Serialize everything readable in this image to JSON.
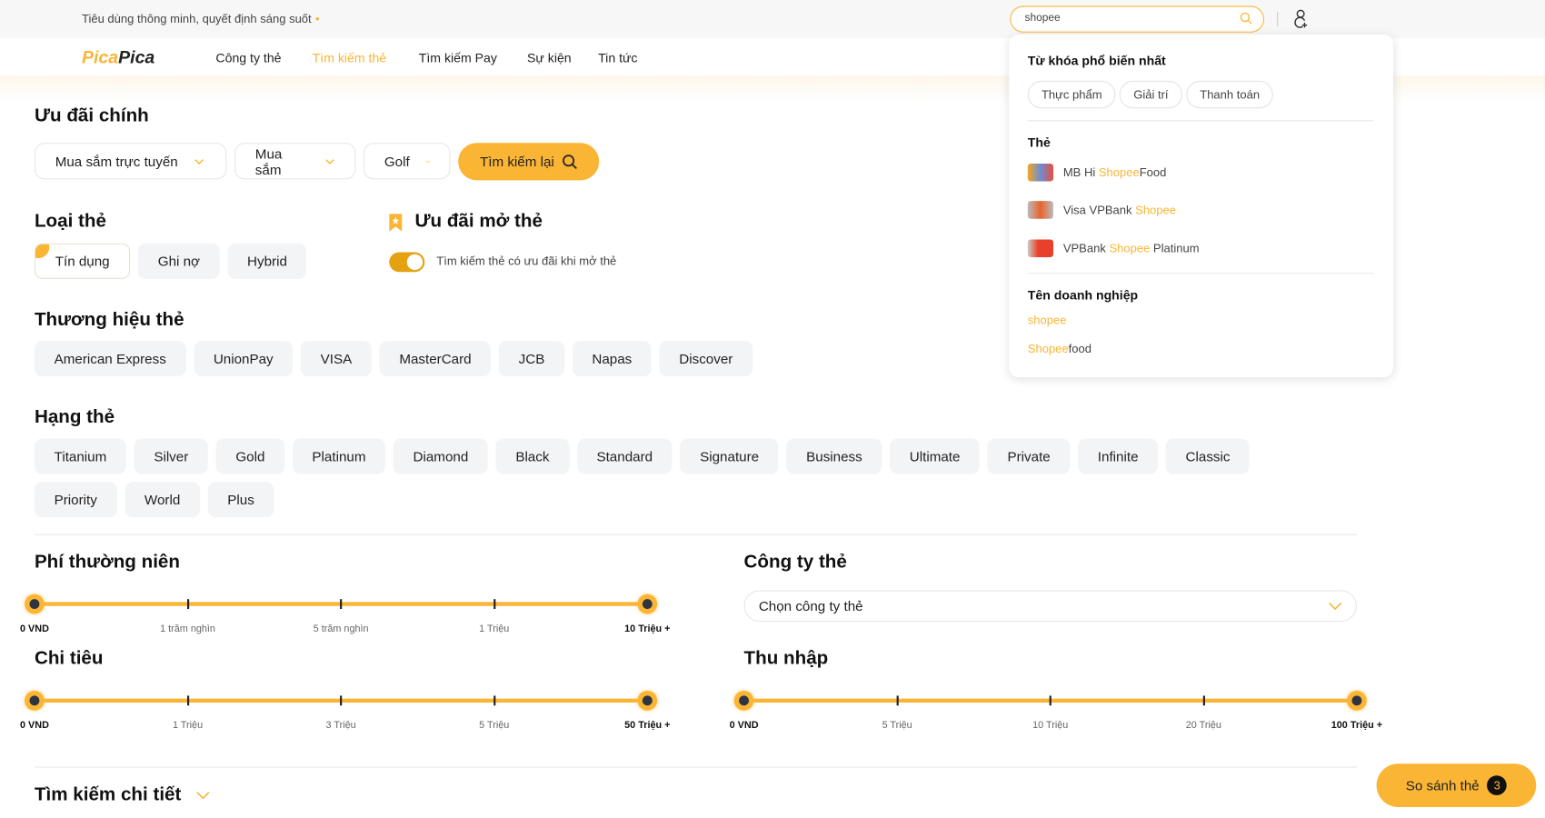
{
  "header": {
    "tagline": "Tiêu dùng thông minh, quyết định sáng suốt",
    "search_value": "shopee",
    "logo": {
      "part1": "Pica",
      "part2": "Pica"
    },
    "nav": [
      {
        "label": "Công ty thẻ",
        "active": false
      },
      {
        "label": "Tìm kiếm thẻ",
        "active": true
      },
      {
        "label": "Tìm kiếm Pay",
        "active": false
      },
      {
        "label": "Sự kiện",
        "active": false
      },
      {
        "label": "Tin tức",
        "active": false
      }
    ]
  },
  "colors": {
    "accent": "#fbb534",
    "toggle": "#e5a10f",
    "chip_bg": "#f3f4f6"
  },
  "main_offer": {
    "title": "Ưu đãi chính",
    "dropdowns": [
      "Mua sắm trực tuyến",
      "Mua sắm",
      "Golf"
    ],
    "search_again": "Tìm kiếm lại"
  },
  "card_type": {
    "title": "Loại thẻ",
    "options": [
      "Tín dụng",
      "Ghi nợ",
      "Hybrid"
    ],
    "selected": "Tín dụng"
  },
  "open_offer": {
    "title": "Ưu đãi mở thẻ",
    "toggle_label": "Tìm kiếm thẻ có ưu đãi khi mở thẻ",
    "toggle_on": true
  },
  "brand": {
    "title": "Thương hiệu thẻ",
    "options": [
      "American Express",
      "UnionPay",
      "VISA",
      "MasterCard",
      "JCB",
      "Napas",
      "Discover"
    ]
  },
  "tier": {
    "title": "Hạng thẻ",
    "row1": [
      "Titanium",
      "Silver",
      "Gold",
      "Platinum",
      "Diamond",
      "Black",
      "Standard",
      "Signature",
      "Business",
      "Ultimate",
      "Private",
      "Infinite",
      "Classic"
    ],
    "row2": [
      "Priority",
      "World",
      "Plus"
    ]
  },
  "annual_fee": {
    "title": "Phí thường niên",
    "labels": [
      "0 VND",
      "1 trăm nghìn",
      "5 trăm nghìn",
      "1 Triệu",
      "10 Triệu +"
    ],
    "min": "0 VND",
    "max": "10 Triệu +"
  },
  "spending": {
    "title": "Chi tiêu",
    "labels": [
      "0 VND",
      "1 Triệu",
      "3 Triệu",
      "5 Triệu",
      "50 Triệu +"
    ],
    "min": "0 VND",
    "max": "50 Triệu +"
  },
  "company": {
    "title": "Công ty thẻ",
    "placeholder": "Chọn công ty thẻ"
  },
  "income": {
    "title": "Thu nhập",
    "labels": [
      "0 VND",
      "5 Triệu",
      "10 Triệu",
      "20 Triệu",
      "100 Triệu +"
    ],
    "min": "0 VND",
    "max": "100 Triệu +"
  },
  "detail_search": "Tìm kiếm chi tiết",
  "compare": {
    "label": "So sánh thẻ",
    "count": "3"
  },
  "suggest": {
    "popular_title": "Từ khóa phổ biến nhất",
    "keywords": [
      "Thực phẩm",
      "Giải trí",
      "Thanh toán"
    ],
    "cards_title": "Thẻ",
    "cards": [
      {
        "pre": "MB Hi ",
        "hl": "Shopee",
        "post": "Food"
      },
      {
        "pre": "Visa VPBank ",
        "hl": "Shopee",
        "post": ""
      },
      {
        "pre": "VPBank ",
        "hl": "Shopee",
        "post": " Platinum"
      }
    ],
    "company_title": "Tên doanh nghiệp",
    "companies": [
      {
        "hl": "shopee",
        "post": ""
      },
      {
        "hl": "Shopee",
        "post": "food"
      }
    ]
  }
}
